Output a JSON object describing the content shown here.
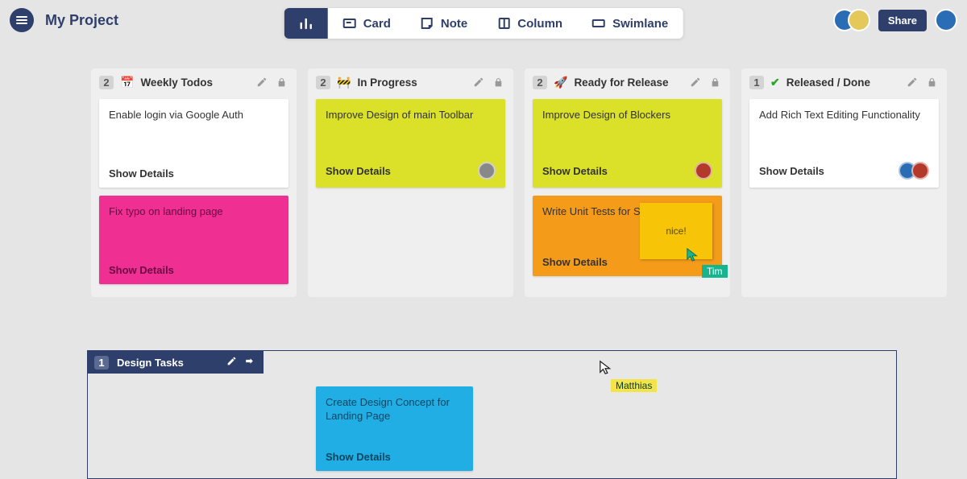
{
  "header": {
    "project_title": "My Project",
    "share_label": "Share"
  },
  "toolbar": {
    "items": [
      {
        "label": ""
      },
      {
        "label": "Card"
      },
      {
        "label": "Note"
      },
      {
        "label": "Column"
      },
      {
        "label": "Swimlane"
      }
    ]
  },
  "columns": [
    {
      "count": "2",
      "emoji": "📅",
      "title": "Weekly Todos",
      "cards": [
        {
          "title": "Enable login via Google Auth",
          "details": "Show Details",
          "color": "white"
        },
        {
          "title": "Fix typo on landing page",
          "details": "Show Details",
          "color": "pink"
        }
      ]
    },
    {
      "count": "2",
      "emoji": "🚧",
      "title": "In Progress",
      "cards": [
        {
          "title": "Improve Design of main Toolbar",
          "details": "Show Details",
          "color": "yellow",
          "avatars": 1
        }
      ]
    },
    {
      "count": "2",
      "emoji": "🚀",
      "title": "Ready for Release",
      "cards": [
        {
          "title": "Improve Design of Blockers",
          "details": "Show Details",
          "color": "yellow",
          "avatars": 1
        },
        {
          "title": "Write Unit Tests for Swim Lanes",
          "details": "Show Details",
          "color": "orange"
        }
      ]
    },
    {
      "count": "1",
      "emoji": "✔",
      "title": "Released / Done",
      "cards": [
        {
          "title": "Add Rich Text Editing Functionality",
          "details": "Show Details",
          "color": "white",
          "avatars": 2
        }
      ]
    }
  ],
  "swimlane": {
    "count": "1",
    "title": "Design Tasks",
    "card": {
      "title": "Create Design Concept for Landing Page",
      "details": "Show Details",
      "color": "cyan"
    }
  },
  "sticky": {
    "text": "nice!"
  },
  "cursors": {
    "tim": "Tim",
    "matthias": "Matthias"
  }
}
